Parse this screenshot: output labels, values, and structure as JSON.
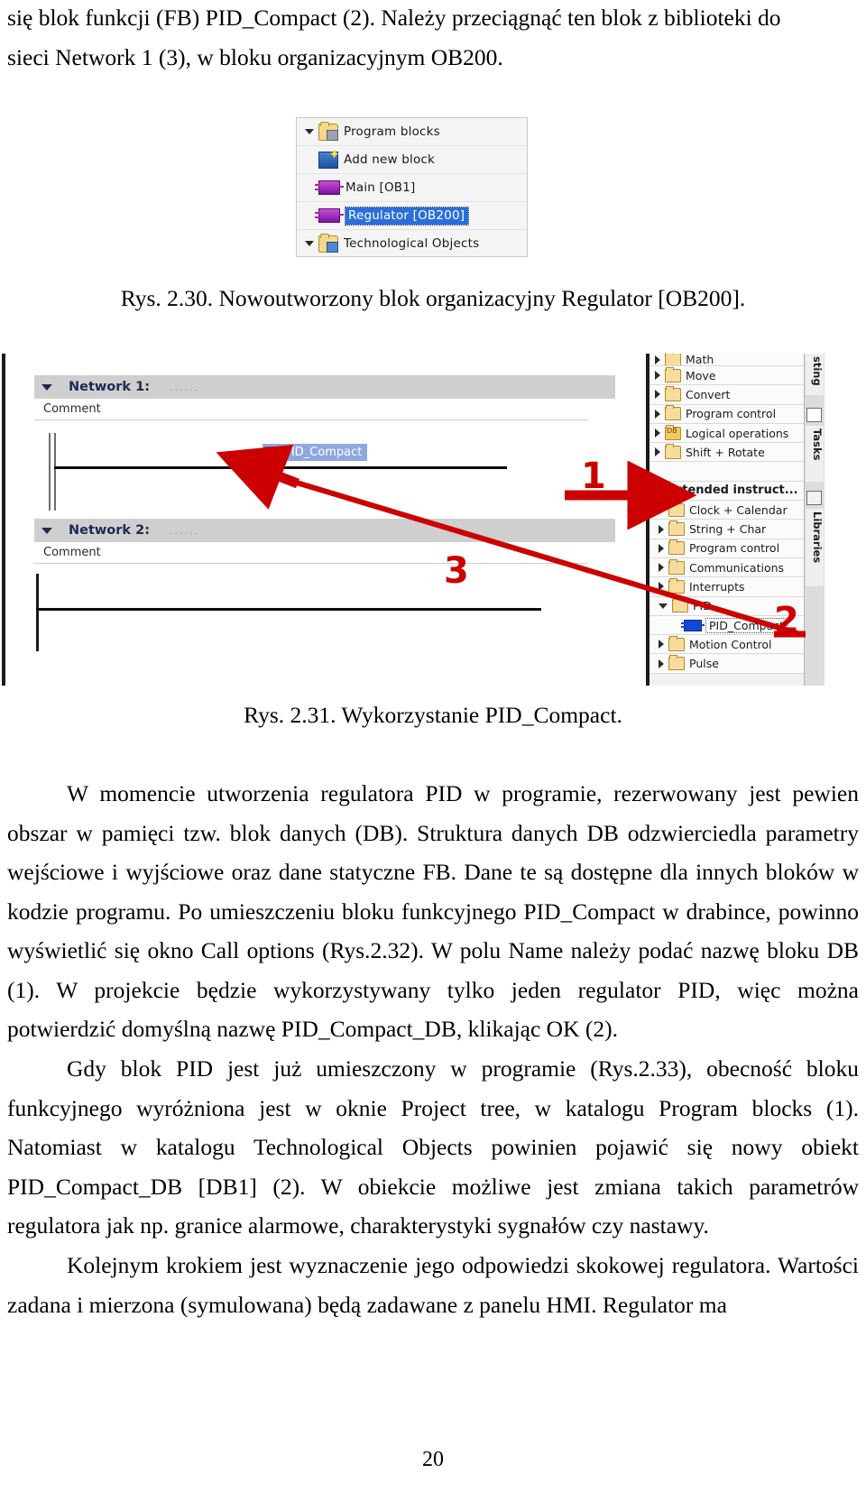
{
  "document": {
    "page_number": "20",
    "paragraphs": {
      "p_top_1": "się blok funkcji (FB) PID_Compact (2). Należy przeciągnąć ten blok z biblioteki do",
      "p_top_2": "sieci Network 1 (3), w bloku organizacyjnym OB200.",
      "p_body_1": "W momencie utworzenia regulatora PID w programie, rezerwowany jest pewien obszar w pamięci tzw. blok danych (DB). Struktura danych DB odzwierciedla parametry wejściowe i wyjściowe oraz dane statyczne FB. Dane te są dostępne dla innych bloków w kodzie programu. Po umieszczeniu bloku funkcyjnego PID_Compact w drabince, powinno wyświetlić się okno Call options (Rys.2.32). W polu Name należy podać nazwę bloku DB (1). W projekcie będzie wykorzystywany tylko jeden regulator PID, więc można potwierdzić domyślną nazwę PID_Compact_DB, klikając OK (2).",
      "p_body_2": "Gdy blok PID jest już umieszczony w programie (Rys.2.33), obecność bloku funkcyjnego wyróżniona jest w oknie Project tree, w katalogu Program blocks (1). Natomiast w katalogu Technological Objects powinien pojawić się nowy obiekt PID_Compact_DB [DB1] (2). W obiekcie możliwe jest zmiana takich parametrów regulatora jak np. granice alarmowe, charakterystyki sygnałów czy nastawy.",
      "p_body_3": "Kolejnym krokiem jest wyznaczenie jego odpowiedzi skokowej regulatora. Wartości zadana i mierzona (symulowana) będą zadawane z panelu HMI. Regulator ma"
    },
    "captions": {
      "fig_230": "Rys. 2.30. Nowoutworzony blok organizacyjny Regulator [OB200].",
      "fig_231": "Rys. 2.31. Wykorzystanie PID_Compact."
    }
  },
  "figure_project_tree": {
    "rows": [
      {
        "label": "Program blocks",
        "icon": "folder-blocks-icon",
        "expander": "down",
        "indent": 0,
        "selected": false
      },
      {
        "label": "Add new block",
        "icon": "add-new-block-icon",
        "expander": "none",
        "indent": 1,
        "selected": false
      },
      {
        "label": "Main [OB1]",
        "icon": "function-block-icon",
        "expander": "none",
        "indent": 1,
        "selected": false
      },
      {
        "label": "Regulator [OB200]",
        "icon": "function-block-icon",
        "expander": "none",
        "indent": 1,
        "selected": true
      },
      {
        "label": "Technological Objects",
        "icon": "folder-tech-icon",
        "expander": "down",
        "indent": 0,
        "selected": false
      }
    ],
    "selection_color": "#2b6ed9"
  },
  "figure_network": {
    "networks": [
      {
        "title": "Network 1:",
        "dots": "......",
        "comment": "Comment"
      },
      {
        "title": "Network 2:",
        "dots": "......",
        "comment": "Comment"
      }
    ],
    "block_chip": "PID_Compact",
    "instructions": {
      "basic_items": [
        {
          "label": "Math",
          "icon": "folder-math-icon",
          "expander": "right",
          "indent": 0,
          "dotted": false
        },
        {
          "label": "Move",
          "icon": "folder-move-icon",
          "expander": "right",
          "indent": 0,
          "dotted": false
        },
        {
          "label": "Convert",
          "icon": "folder-convert-icon",
          "expander": "right",
          "indent": 0,
          "dotted": false
        },
        {
          "label": "Program control",
          "icon": "folder-program-control-icon",
          "expander": "right",
          "indent": 0,
          "dotted": false
        },
        {
          "label": "Logical operations",
          "icon": "folder-db-icon",
          "expander": "right",
          "indent": 0,
          "dotted": false
        },
        {
          "label": "Shift + Rotate",
          "icon": "folder-shift-rotate-icon",
          "expander": "right",
          "indent": 0,
          "dotted": false
        }
      ],
      "extended_header": "Extended instruct...",
      "extended_items": [
        {
          "label": "Clock + Calendar",
          "icon": "folder-icon",
          "expander": "right",
          "indent": 0,
          "dotted": false
        },
        {
          "label": "String + Char",
          "icon": "folder-icon",
          "expander": "right",
          "indent": 0,
          "dotted": false
        },
        {
          "label": "Program control",
          "icon": "folder-icon",
          "expander": "right",
          "indent": 0,
          "dotted": false
        },
        {
          "label": "Communications",
          "icon": "folder-icon",
          "expander": "right",
          "indent": 0,
          "dotted": false
        },
        {
          "label": "Interrupts",
          "icon": "folder-icon",
          "expander": "right",
          "indent": 0,
          "dotted": false
        },
        {
          "label": "PID",
          "icon": "folder-icon",
          "expander": "down",
          "indent": 0,
          "dotted": false
        },
        {
          "label": "PID_Compact",
          "icon": "function-block-blue-icon",
          "expander": "none",
          "indent": 1,
          "dotted": true
        },
        {
          "label": "Motion Control",
          "icon": "folder-icon",
          "expander": "right",
          "indent": 0,
          "dotted": false
        },
        {
          "label": "Pulse",
          "icon": "folder-icon",
          "expander": "right",
          "indent": 0,
          "dotted": false
        }
      ]
    },
    "task_tabs": [
      {
        "label": "sting",
        "icon": "testing-icon"
      },
      {
        "label": "Tasks",
        "icon": "tasks-icon"
      },
      {
        "label": "Libraries",
        "icon": "libraries-icon"
      }
    ],
    "annotations": [
      {
        "number": "1",
        "target": "extended-instructions-header",
        "color": "#cc0000"
      },
      {
        "number": "2",
        "target": "pid-compact-instruction",
        "color": "#cc0000"
      },
      {
        "number": "3",
        "target": "network-1-drop-point",
        "color": "#cc0000"
      }
    ]
  }
}
